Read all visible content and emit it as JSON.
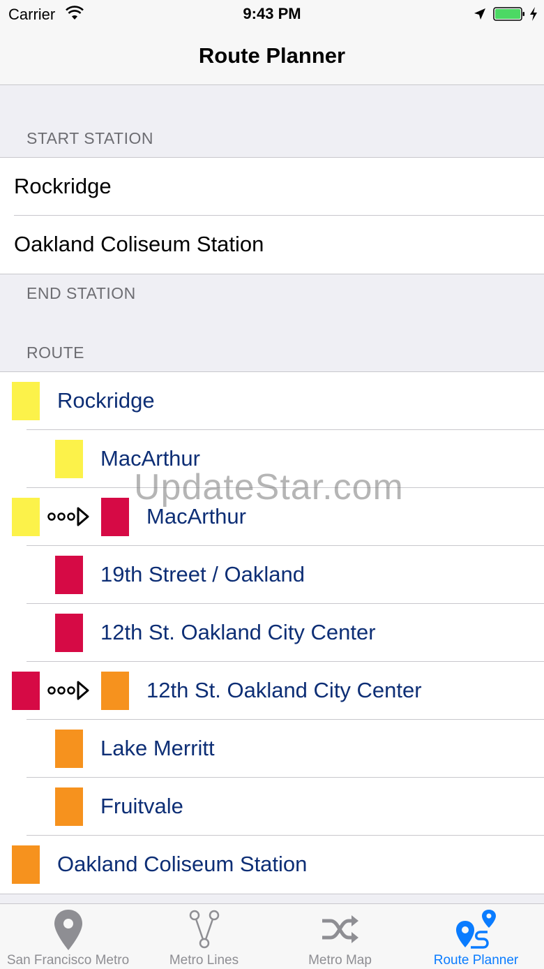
{
  "status_bar": {
    "carrier": "Carrier",
    "time": "9:43 PM"
  },
  "nav": {
    "title": "Route Planner"
  },
  "start_section": {
    "header": "START STATION",
    "items": [
      "Rockridge",
      "Oakland Coliseum Station"
    ]
  },
  "end_section": {
    "header": "END STATION"
  },
  "route_section": {
    "header": "ROUTE",
    "colors": {
      "yellow": "#fcf24a",
      "red": "#d60a45",
      "orange": "#f6921e",
      "text": "#0d2e75"
    },
    "stops": [
      {
        "label": "Rockridge",
        "kind": "endpoint",
        "color": "yellow"
      },
      {
        "label": "MacArthur",
        "kind": "stop",
        "color": "yellow"
      },
      {
        "label": "MacArthur",
        "kind": "transfer",
        "from_color": "yellow",
        "color": "red"
      },
      {
        "label": "19th Street / Oakland",
        "kind": "stop",
        "color": "red"
      },
      {
        "label": "12th St. Oakland City Center",
        "kind": "stop",
        "color": "red"
      },
      {
        "label": "12th St. Oakland City Center",
        "kind": "transfer",
        "from_color": "red",
        "color": "orange"
      },
      {
        "label": "Lake Merritt",
        "kind": "stop",
        "color": "orange"
      },
      {
        "label": "Fruitvale",
        "kind": "stop",
        "color": "orange"
      },
      {
        "label": "Oakland Coliseum Station",
        "kind": "endpoint",
        "color": "orange"
      }
    ]
  },
  "watermark": "UpdateStar.com",
  "tab_bar": {
    "active_color": "#0a7cff",
    "inactive_color": "#8e8e93",
    "tabs": [
      {
        "label": "San Francisco Metro",
        "icon": "map-pin-icon",
        "active": false
      },
      {
        "label": "Metro Lines",
        "icon": "branch-lines-icon",
        "active": false
      },
      {
        "label": "Metro Map",
        "icon": "shuffle-icon",
        "active": false
      },
      {
        "label": "Route Planner",
        "icon": "route-planner-icon",
        "active": true
      }
    ]
  }
}
